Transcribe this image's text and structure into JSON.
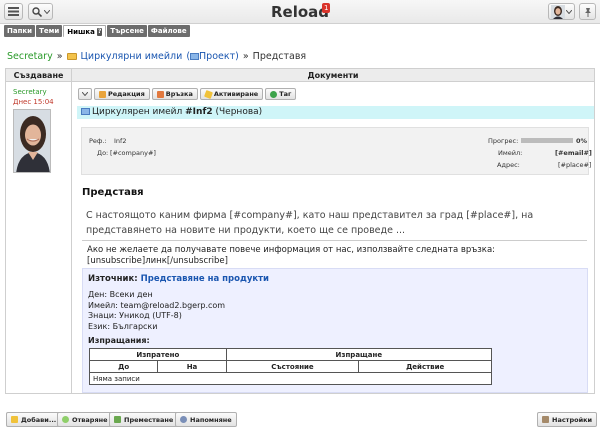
{
  "header": {
    "app_title": "Reload",
    "notification_count": "1"
  },
  "tabs": [
    {
      "label": "Папки"
    },
    {
      "label": "Теми"
    },
    {
      "label": "Нишка",
      "badge": "?"
    },
    {
      "label": "Търсене"
    },
    {
      "label": "Файлове"
    }
  ],
  "breadcrumb": {
    "root": "Secretary",
    "folder": "Циркулярни имейли",
    "project": "Проект",
    "current": "Представя",
    "sep": "»"
  },
  "columns": {
    "left": "Създаване",
    "right": "Документи"
  },
  "author": {
    "name": "Secretary",
    "date": "Днес 15:04"
  },
  "toolbar": {
    "edit": "Редакция",
    "link": "Връзка",
    "activate": "Активиране",
    "tag": "Таг"
  },
  "document": {
    "type_label": "Циркулярен имейл",
    "number": "#Inf2",
    "status": "(Чернова)",
    "ref_label": "Реф.:",
    "ref_value": "Inf2",
    "to_label": "До:",
    "to_value": "[#company#]",
    "progress_label": "Прогрес:",
    "progress_percent": "0%",
    "progress_value": 0,
    "email_label": "Имейл:",
    "email_value": "[#email#]",
    "address_label": "Адрес:",
    "address_value": "[#place#]"
  },
  "content": {
    "heading": "Представя",
    "body": "С настоящото каним фирма [#company#], като наш представител за град [#place#], на представянето на новите ни продукти, което ще се проведе ...",
    "unsubscribe_line1": "Ако не желаете да получавате повече информация от нас, използвайте следната връзка:",
    "unsubscribe_line2": "[unsubscribe]линк[/unsubscribe]"
  },
  "source": {
    "label": "Източник:",
    "name": "Представяне на продукти",
    "day": "Ден: Всеки ден",
    "email": "Имейл: team@reload2.bgerp.com",
    "charset": "Знаци: Уникод (UTF-8)",
    "language": "Език: Български",
    "sent_label": "Изпращания:"
  },
  "sent_table": {
    "group_sent": "Изпратено",
    "group_sending": "Изпращане",
    "col_from": "До",
    "col_to": "На",
    "col_state": "Състояние",
    "col_action": "Действие",
    "empty": "Няма записи"
  },
  "bottom": {
    "add": "Добави...",
    "open": "Отваряне",
    "move": "Преместване",
    "remind": "Напомняне",
    "settings": "Настройки"
  },
  "colors": {
    "accent_link": "#1a56b0",
    "secretary_green": "#2a9a2a",
    "date_red": "#c0392b",
    "title_bg": "#cff5f8",
    "source_bg": "#eef0ff"
  }
}
